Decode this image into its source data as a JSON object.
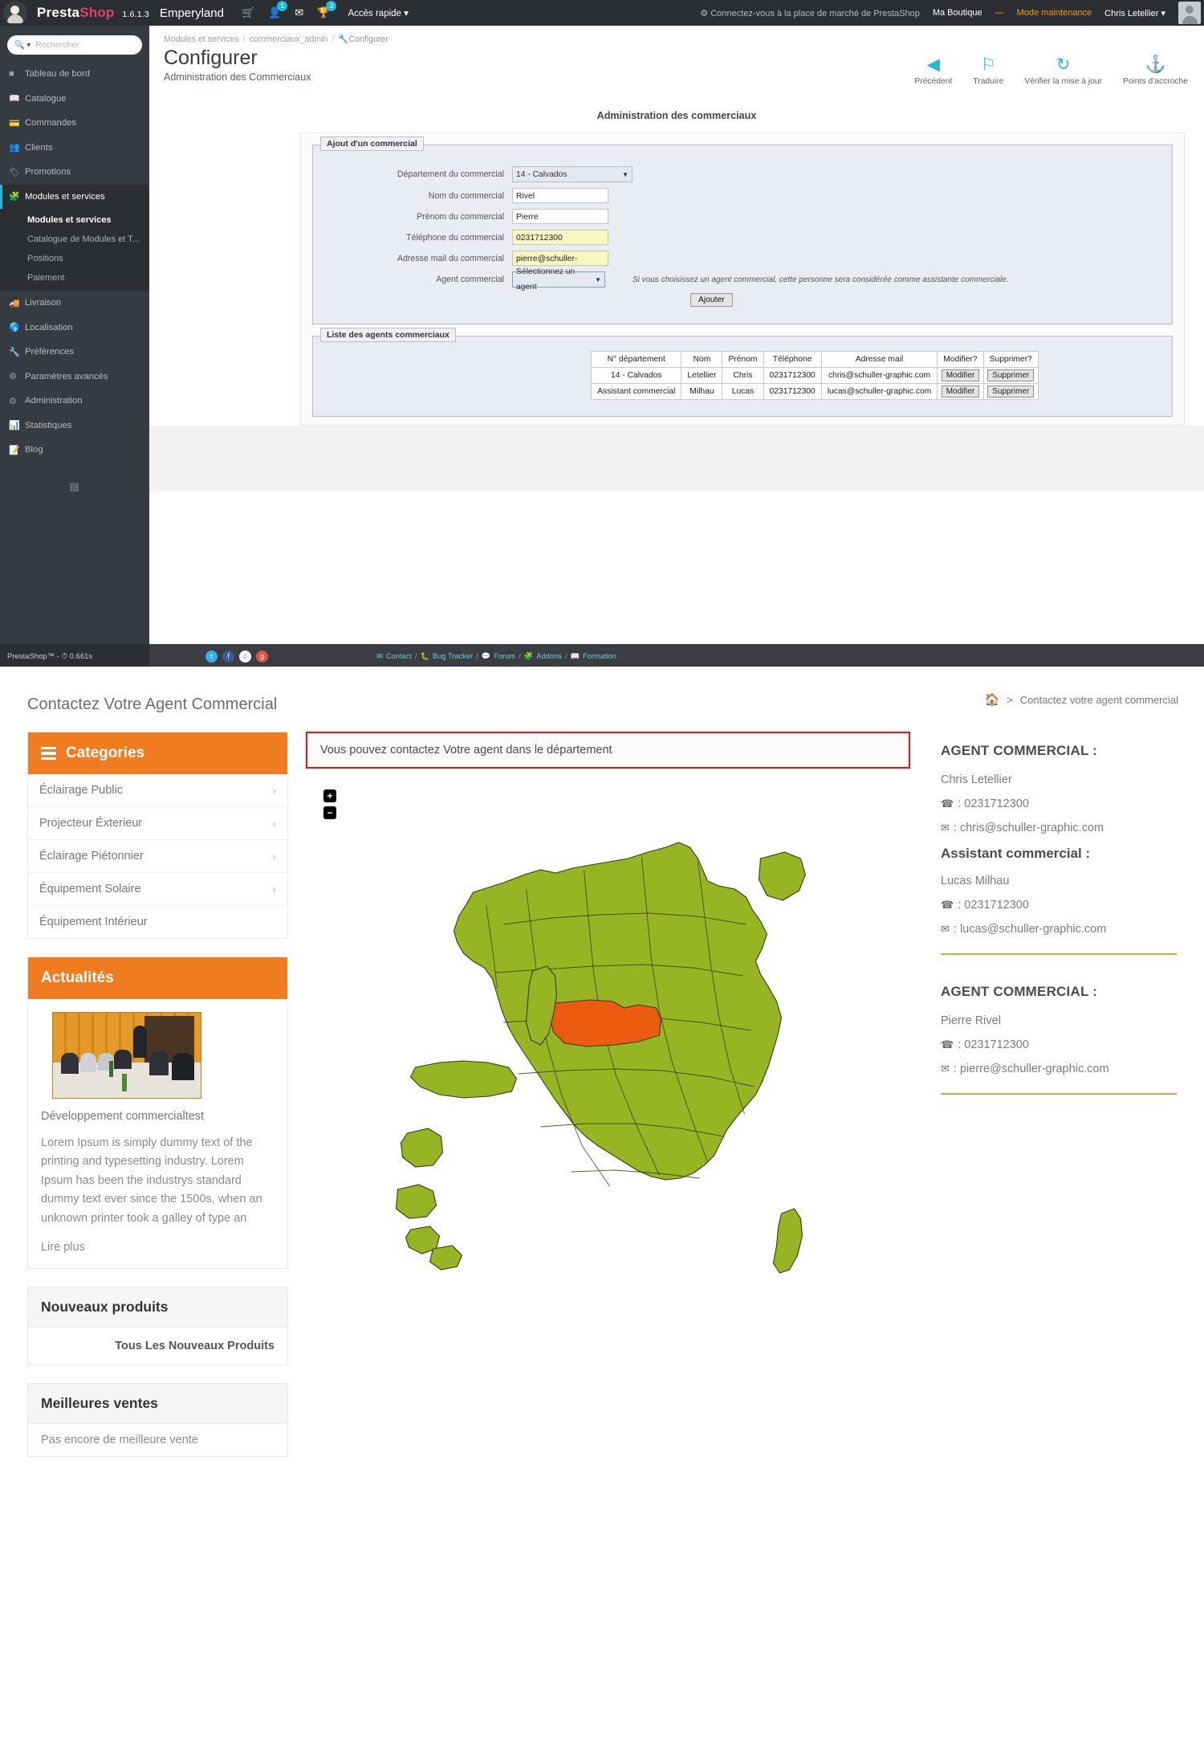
{
  "admin": {
    "brand": {
      "part1": "Presta",
      "part2": "Shop",
      "version": "1.6.1.3",
      "shop": "Emperyland"
    },
    "topbar": {
      "cart_icon": "cart-icon",
      "customers_icon": "customers-icon",
      "customers_badge": "1",
      "messages_icon": "envelope-icon",
      "trophy_icon": "trophy-icon",
      "trophy_badge": "3",
      "quick_access": "Accès rapide",
      "marketplace": "Connectez-vous à la place de marché de PrestaShop",
      "shop_label": "Ma Boutique",
      "dash": "—",
      "maintenance": "Mode maintenance",
      "user": "Chris Letellier"
    },
    "search": {
      "placeholder": "Rechercher"
    },
    "menu": [
      {
        "label": "Tableau de bord",
        "icon": "dashboard-icon"
      },
      {
        "label": "Catalogue",
        "icon": "catalog-icon"
      },
      {
        "label": "Commandes",
        "icon": "orders-icon"
      },
      {
        "label": "Clients",
        "icon": "customers-icon"
      },
      {
        "label": "Promotions",
        "icon": "promotions-icon"
      },
      {
        "label": "Modules et services",
        "icon": "modules-icon",
        "active": true
      },
      {
        "label": "Livraison",
        "icon": "shipping-icon"
      },
      {
        "label": "Localisation",
        "icon": "globe-icon"
      },
      {
        "label": "Préférences",
        "icon": "wrench-icon"
      },
      {
        "label": "Paramètres avancés",
        "icon": "gears-icon"
      },
      {
        "label": "Administration",
        "icon": "gear-icon"
      },
      {
        "label": "Statistiques",
        "icon": "chart-icon"
      },
      {
        "label": "Blog",
        "icon": "blog-icon"
      }
    ],
    "submenu": [
      {
        "label": "Modules et services",
        "active": true
      },
      {
        "label": "Catalogue de Modules et T..."
      },
      {
        "label": "Positions"
      },
      {
        "label": "Paiement"
      }
    ],
    "breadcrumb": [
      "Modules et services",
      "commerciaux_admin",
      "Configurer"
    ],
    "page": {
      "title": "Configurer",
      "subtitle": "Administration des Commerciaux"
    },
    "toolbar": [
      {
        "label": "Précédent",
        "icon": "back-arrow-icon"
      },
      {
        "label": "Traduire",
        "icon": "flag-icon"
      },
      {
        "label": "Vérifier la mise à jour",
        "icon": "refresh-icon"
      },
      {
        "label": "Points d'accroche",
        "icon": "anchor-icon"
      }
    ],
    "panel_title": "Administration des commerciaux",
    "add_form": {
      "legend": "Ajout d'un commercial",
      "fields": [
        {
          "label": "Département du commercial",
          "type": "select",
          "value": "14 - Calvados"
        },
        {
          "label": "Nom du commercial",
          "type": "text",
          "value": "Rivel"
        },
        {
          "label": "Prénom du commercial",
          "type": "text",
          "value": "Pierre"
        },
        {
          "label": "Téléphone du commercial",
          "type": "text",
          "value": "0231712300",
          "highlight": true
        },
        {
          "label": "Adresse mail du commercial",
          "type": "text",
          "value": "pierre@schuller-graphic",
          "highlight": true
        },
        {
          "label": "Agent commercial",
          "type": "select-blue",
          "value": "Sélectionnez un agent"
        }
      ],
      "hint": "Si vous choisissez un agent commercial, cette personne sera considérée comme assistante commerciale.",
      "submit": "Ajouter"
    },
    "list": {
      "legend": "Liste des agents commerciaux",
      "headers": [
        "N° département",
        "Nom",
        "Prénom",
        "Téléphone",
        "Adresse mail",
        "Modifier?",
        "Supprimer?"
      ],
      "rows": [
        {
          "dept": "14 - Calvados",
          "nom": "Letellier",
          "prenom": "Chris",
          "tel": "0231712300",
          "mail": "chris@schuller-graphic.com",
          "edit": "Modifier",
          "del": "Supprimer"
        },
        {
          "dept": "Assistant commercial",
          "nom": "Milhau",
          "prenom": "Lucas",
          "tel": "0231712300",
          "mail": "lucas@schuller-graphic.com",
          "edit": "Modifier",
          "del": "Supprimer"
        }
      ]
    },
    "footer": {
      "version": "PrestaShop™ - ⏱ 0.661s",
      "socials": [
        "twitter-icon",
        "facebook-icon",
        "github-icon",
        "googleplus-icon"
      ],
      "links": [
        "Contact",
        "Bug Tracker",
        "Forum",
        "Addons",
        "Formation"
      ]
    }
  },
  "front": {
    "page_title": "Contactez Votre Agent Commercial",
    "breadcrumb": {
      "home_icon": "home-icon",
      "sep": ">",
      "current": "Contactez votre agent commercial"
    },
    "categories": {
      "title": "Categories",
      "items": [
        {
          "label": "Éclairage Public",
          "has_arrow": true
        },
        {
          "label": "Projecteur Éxterieur",
          "has_arrow": true
        },
        {
          "label": "Éclairage Piétonnier",
          "has_arrow": true
        },
        {
          "label": "Équipement Solaire",
          "has_arrow": true
        },
        {
          "label": "Équipement Intérieur",
          "has_arrow": false
        }
      ]
    },
    "news": {
      "title": "Actualités",
      "item_title": "Développement commercialtest",
      "text": "Lorem Ipsum is simply dummy text of the printing and typesetting industry. Lorem Ipsum has been the industrys standard dummy text ever since the 1500s, when an unknown printer took a galley of type an",
      "more": "Lire plus"
    },
    "new_products": {
      "title": "Nouveaux produits",
      "link": "Tous Les Nouveaux Produits"
    },
    "best_sellers": {
      "title": "Meilleures ventes",
      "empty": "Pas encore de meilleure vente"
    },
    "alert": "Vous pouvez contactez Votre agent dans le département",
    "map": {
      "zoom_in": "+",
      "zoom_out": "−",
      "selected_color": "#ec5c10",
      "base_color": "#97b522"
    },
    "agents": [
      {
        "heading": "AGENT COMMERCIAL :",
        "name": "Chris Letellier",
        "phone_icon": "phone-icon",
        "phone": ": 0231712300",
        "mail_icon": "envelope-icon",
        "mail": ": chris@schuller-graphic.com",
        "assistant_heading": "Assistant commercial :",
        "assistant_name": "Lucas Milhau",
        "assistant_phone": ": 0231712300",
        "assistant_mail": ": lucas@schuller-graphic.com"
      },
      {
        "heading": "AGENT COMMERCIAL :",
        "name": "Pierre Rivel",
        "phone_icon": "phone-icon",
        "phone": ": 0231712300",
        "mail_icon": "envelope-icon",
        "mail": ": pierre@schuller-graphic.com"
      }
    ]
  }
}
